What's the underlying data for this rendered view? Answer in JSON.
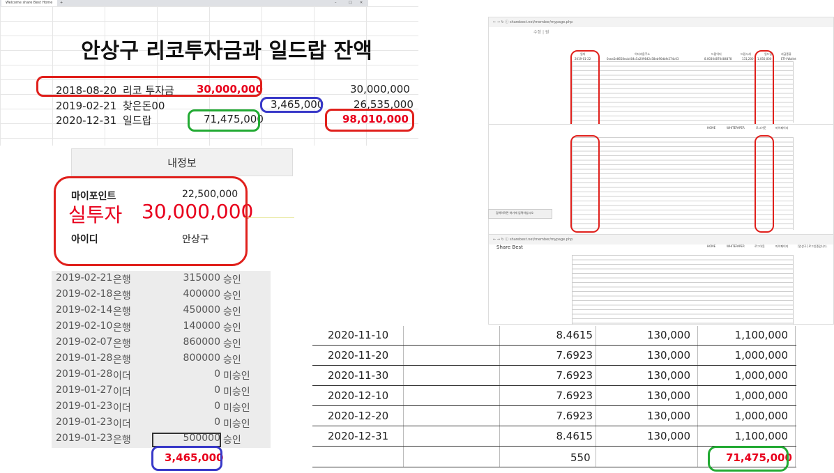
{
  "browser_tab": {
    "title": "Welcome share Best Home",
    "new_tab": "+"
  },
  "title": "안상구 리코투자금과 일드랍 잔액",
  "summary": [
    {
      "date": "2018-08-20",
      "label": "리코 투자금",
      "amount": "30,000,000",
      "balance": "30,000,000"
    },
    {
      "date": "2019-02-21",
      "label": "찾은돈00",
      "amount": "3,465,000",
      "balance": "26,535,000"
    },
    {
      "date": "2020-12-31",
      "label": "일드랍",
      "amount": "71,475,000",
      "balance": "98,010,000"
    }
  ],
  "info_panel": {
    "header": "내정보",
    "point_label": "마이포인트",
    "point_value": "22,500,000",
    "real_label": "실투자",
    "real_value": "30,000,000",
    "id_label": "아이디",
    "id_value": "안상구"
  },
  "bank_rows": [
    {
      "date": "2019-02-21",
      "type": "은행",
      "amount": "315000",
      "status": "승인"
    },
    {
      "date": "2019-02-18",
      "type": "은행",
      "amount": "400000",
      "status": "승인"
    },
    {
      "date": "2019-02-14",
      "type": "은행",
      "amount": "450000",
      "status": "승인"
    },
    {
      "date": "2019-02-10",
      "type": "은행",
      "amount": "140000",
      "status": "승인"
    },
    {
      "date": "2019-02-07",
      "type": "은행",
      "amount": "860000",
      "status": "승인"
    },
    {
      "date": "2019-01-28",
      "type": "은행",
      "amount": "800000",
      "status": "승인"
    },
    {
      "date": "2019-01-28",
      "type": "이더",
      "amount": "0",
      "status": "미승인"
    },
    {
      "date": "2019-01-27",
      "type": "이더",
      "amount": "0",
      "status": "미승인"
    },
    {
      "date": "2019-01-23",
      "type": "이더",
      "amount": "0",
      "status": "미승인"
    },
    {
      "date": "2019-01-23",
      "type": "이더",
      "amount": "0",
      "status": "미승인"
    },
    {
      "date": "2019-01-23",
      "type": "은행",
      "amount": "500000",
      "status": "승인"
    }
  ],
  "bank_total": "3,465,000",
  "shot_top": {
    "url": "sharebest.net/member/mypage.php",
    "headers": [
      "일자",
      "이더리움주소",
      "드랍이더",
      "드랍시세",
      "일드랍",
      "지급종류"
    ],
    "first_row": [
      "2019-01-22",
      "0xea5e8658ecb404c5a209842c58eb90dbfe274c03",
      "8.00304870484878",
      "131,200",
      "1,050,000",
      "ETH Wallet"
    ],
    "menu": [
      "HOME",
      "WHITEPAPER",
      "로그아웃",
      "마이페이지"
    ]
  },
  "shot_mid": {
    "taskbar_search": "검색하려면 여기에 입력하십시오"
  },
  "shot_bottom": {
    "brand": "Share Best",
    "url": "sharebest.net/member/mypage.php",
    "menu": [
      "HOME",
      "WHITEPAPER",
      "로그아웃",
      "마이페이지",
      "[안상구] 로그인중입니다."
    ]
  },
  "big_table": [
    {
      "date": "2020-11-10",
      "rate": "8.4615",
      "price": "130,000",
      "amount": "1,100,000"
    },
    {
      "date": "2020-11-20",
      "rate": "7.6923",
      "price": "130,000",
      "amount": "1,000,000"
    },
    {
      "date": "2020-11-30",
      "rate": "7.6923",
      "price": "130,000",
      "amount": "1,000,000"
    },
    {
      "date": "2020-12-10",
      "rate": "7.6923",
      "price": "130,000",
      "amount": "1,000,000"
    },
    {
      "date": "2020-12-20",
      "rate": "7.6923",
      "price": "130,000",
      "amount": "1,000,000"
    },
    {
      "date": "2020-12-31",
      "rate": "8.4615",
      "price": "130,000",
      "amount": "1,100,000"
    }
  ],
  "big_total": {
    "rate_sum": "550",
    "amount_sum": "71,475,000"
  },
  "colors": {
    "red": "#e8001c",
    "blue": "#3838c8",
    "green": "#22aa33"
  }
}
